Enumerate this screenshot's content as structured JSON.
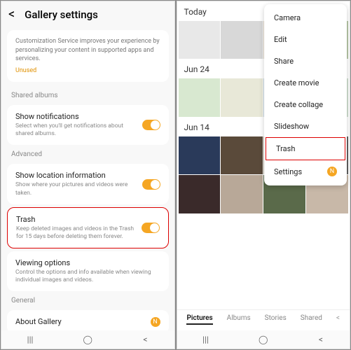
{
  "left": {
    "title": "Gallery settings",
    "cs": {
      "text": "Customization Service improves your experience by personalizing your content in supported apps and services.",
      "unused": "Unused"
    },
    "sec_shared": "Shared albums",
    "notif": {
      "t": "Show notifications",
      "d": "Select when you'll get notifications about shared albums."
    },
    "sec_adv": "Advanced",
    "loc": {
      "t": "Show location information",
      "d": "Show where your pictures and videos were taken."
    },
    "trash": {
      "t": "Trash",
      "d": "Keep deleted images and videos in the Trash for 15 days before deleting them forever."
    },
    "view": {
      "t": "Viewing options",
      "d": "Control the options and info available when viewing individual images and videos."
    },
    "sec_gen": "General",
    "about": {
      "t": "About Gallery",
      "badge": "N"
    }
  },
  "right": {
    "menu": [
      "Camera",
      "Edit",
      "Share",
      "Create movie",
      "Create collage",
      "Slideshow",
      "Trash",
      "Settings"
    ],
    "badge": "N",
    "d1": "Today",
    "d2": "Jun 24",
    "d3": "Jun 14",
    "tabs": [
      "Pictures",
      "Albums",
      "Stories",
      "Shared"
    ],
    "thumbs": {
      "today": [
        "#e8e8e8",
        "#d8d8d8",
        "#e0d8c8",
        "#b8c8a8"
      ],
      "j24": [
        "#d8e8d0",
        "#e8e8d8",
        "#c8d8e0",
        "#d0e0d0"
      ],
      "j14": [
        "#2a3a5a",
        "#5a4a3a",
        "#c0b8a8",
        "#606060",
        "#3a2a2a",
        "#b8a898",
        "#5a6a4a",
        "#c8b8a8"
      ]
    }
  },
  "nav": {
    "recent": "|||",
    "home": "◯",
    "back": "<"
  }
}
